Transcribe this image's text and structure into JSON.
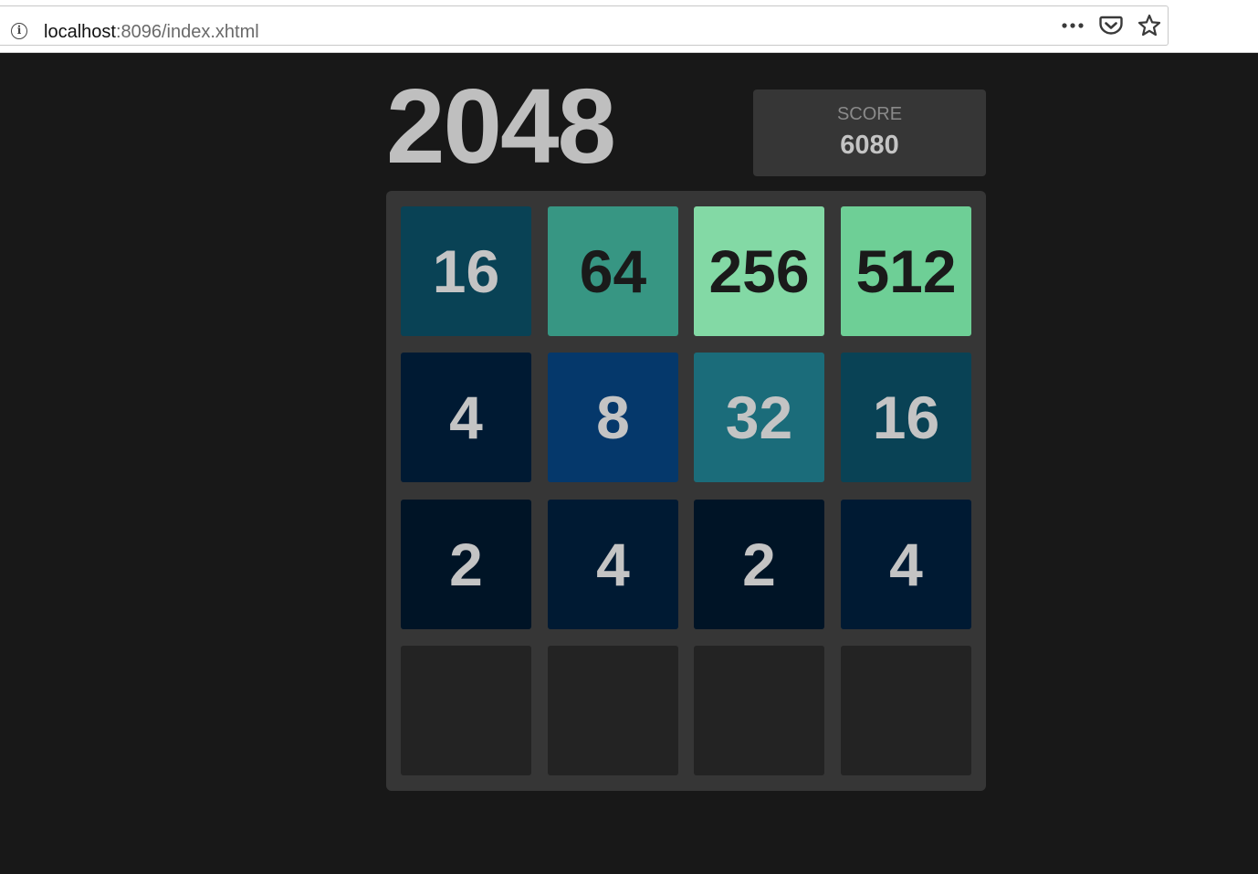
{
  "browser": {
    "url_host": "localhost",
    "url_rest": ":8096/index.xhtml",
    "icons": [
      "info-icon",
      "more-icon",
      "pocket-icon",
      "star-icon"
    ]
  },
  "game": {
    "title": "2048",
    "score_label": "SCORE",
    "score_value": "6080",
    "board": [
      [
        "16",
        "64",
        "256",
        "512"
      ],
      [
        "4",
        "8",
        "32",
        "16"
      ],
      [
        "2",
        "4",
        "2",
        "4"
      ],
      [
        "",
        "",
        "",
        ""
      ]
    ],
    "tile_colors": {
      "": {
        "bg": "#232323",
        "fg": "#c4c4c4"
      },
      "2": {
        "bg": "#001426",
        "fg": "#c4c4c4"
      },
      "4": {
        "bg": "#001a33",
        "fg": "#c4c4c4"
      },
      "8": {
        "bg": "#05386b",
        "fg": "#c4c4c4"
      },
      "16": {
        "bg": "#094255",
        "fg": "#c4c4c4"
      },
      "32": {
        "bg": "#1b6c7a",
        "fg": "#c4c4c4"
      },
      "64": {
        "bg": "#379683",
        "fg": "#1a1a1a"
      },
      "256": {
        "bg": "#83d9a5",
        "fg": "#1a1a1a"
      },
      "512": {
        "bg": "#6ecf96",
        "fg": "#1a1a1a"
      }
    }
  }
}
